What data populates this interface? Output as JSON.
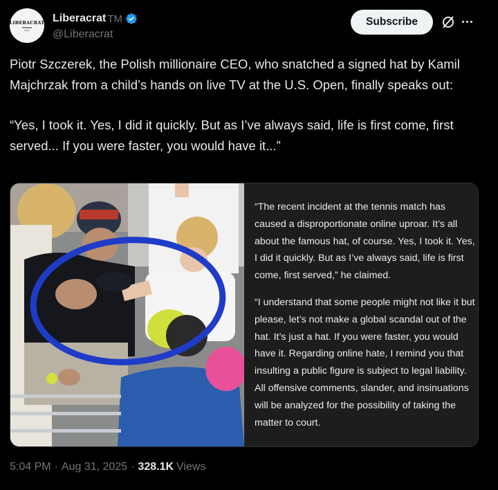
{
  "author": {
    "display_name": "Liberacrat",
    "tm": "TM",
    "handle": "@Liberacrat",
    "avatar_text": "LIBERACRAT"
  },
  "actions": {
    "subscribe_label": "Subscribe"
  },
  "tweet": {
    "paragraph_1": "Piotr Szczerek, the Polish millionaire CEO, who snatched a signed hat by Kamil Majchrzak from a child’s hands on live TV at the U.S. Open, finally speaks out:",
    "paragraph_2": "“Yes, I took it. Yes, I did it quickly. But as I’ve always said, life is first come, first served... If you were faster, you would have it...”"
  },
  "media": {
    "quote_1": "“The recent incident at the tennis match has caused a disproportionate online uproar. It’s all about the famous hat, of course. Yes, I took it. Yes, I did it quickly. But as I’ve always said, life is first come, first served,” he claimed.",
    "quote_2": "“I understand that some people might not like it but please, let’s not make a global scandal out of the hat. It’s just a hat. If you were faster, you would have it. Regarding online hate, I remind you that insulting a public figure is subject to legal liability. All offensive comments, slander, and insinuations will be analyzed for the possibility of taking the matter to court."
  },
  "meta": {
    "time": "5:04 PM",
    "date": "Aug 31, 2025",
    "views_count": "328.1K",
    "views_label": "Views",
    "separator": "·"
  },
  "colors": {
    "background": "#000000",
    "verified_blue": "#1d9bf0",
    "secondary_text": "#71767b",
    "circle_annotation": "#1e3cc8"
  },
  "icons": [
    "verified-badge-icon",
    "grok-icon",
    "more-icon"
  ]
}
